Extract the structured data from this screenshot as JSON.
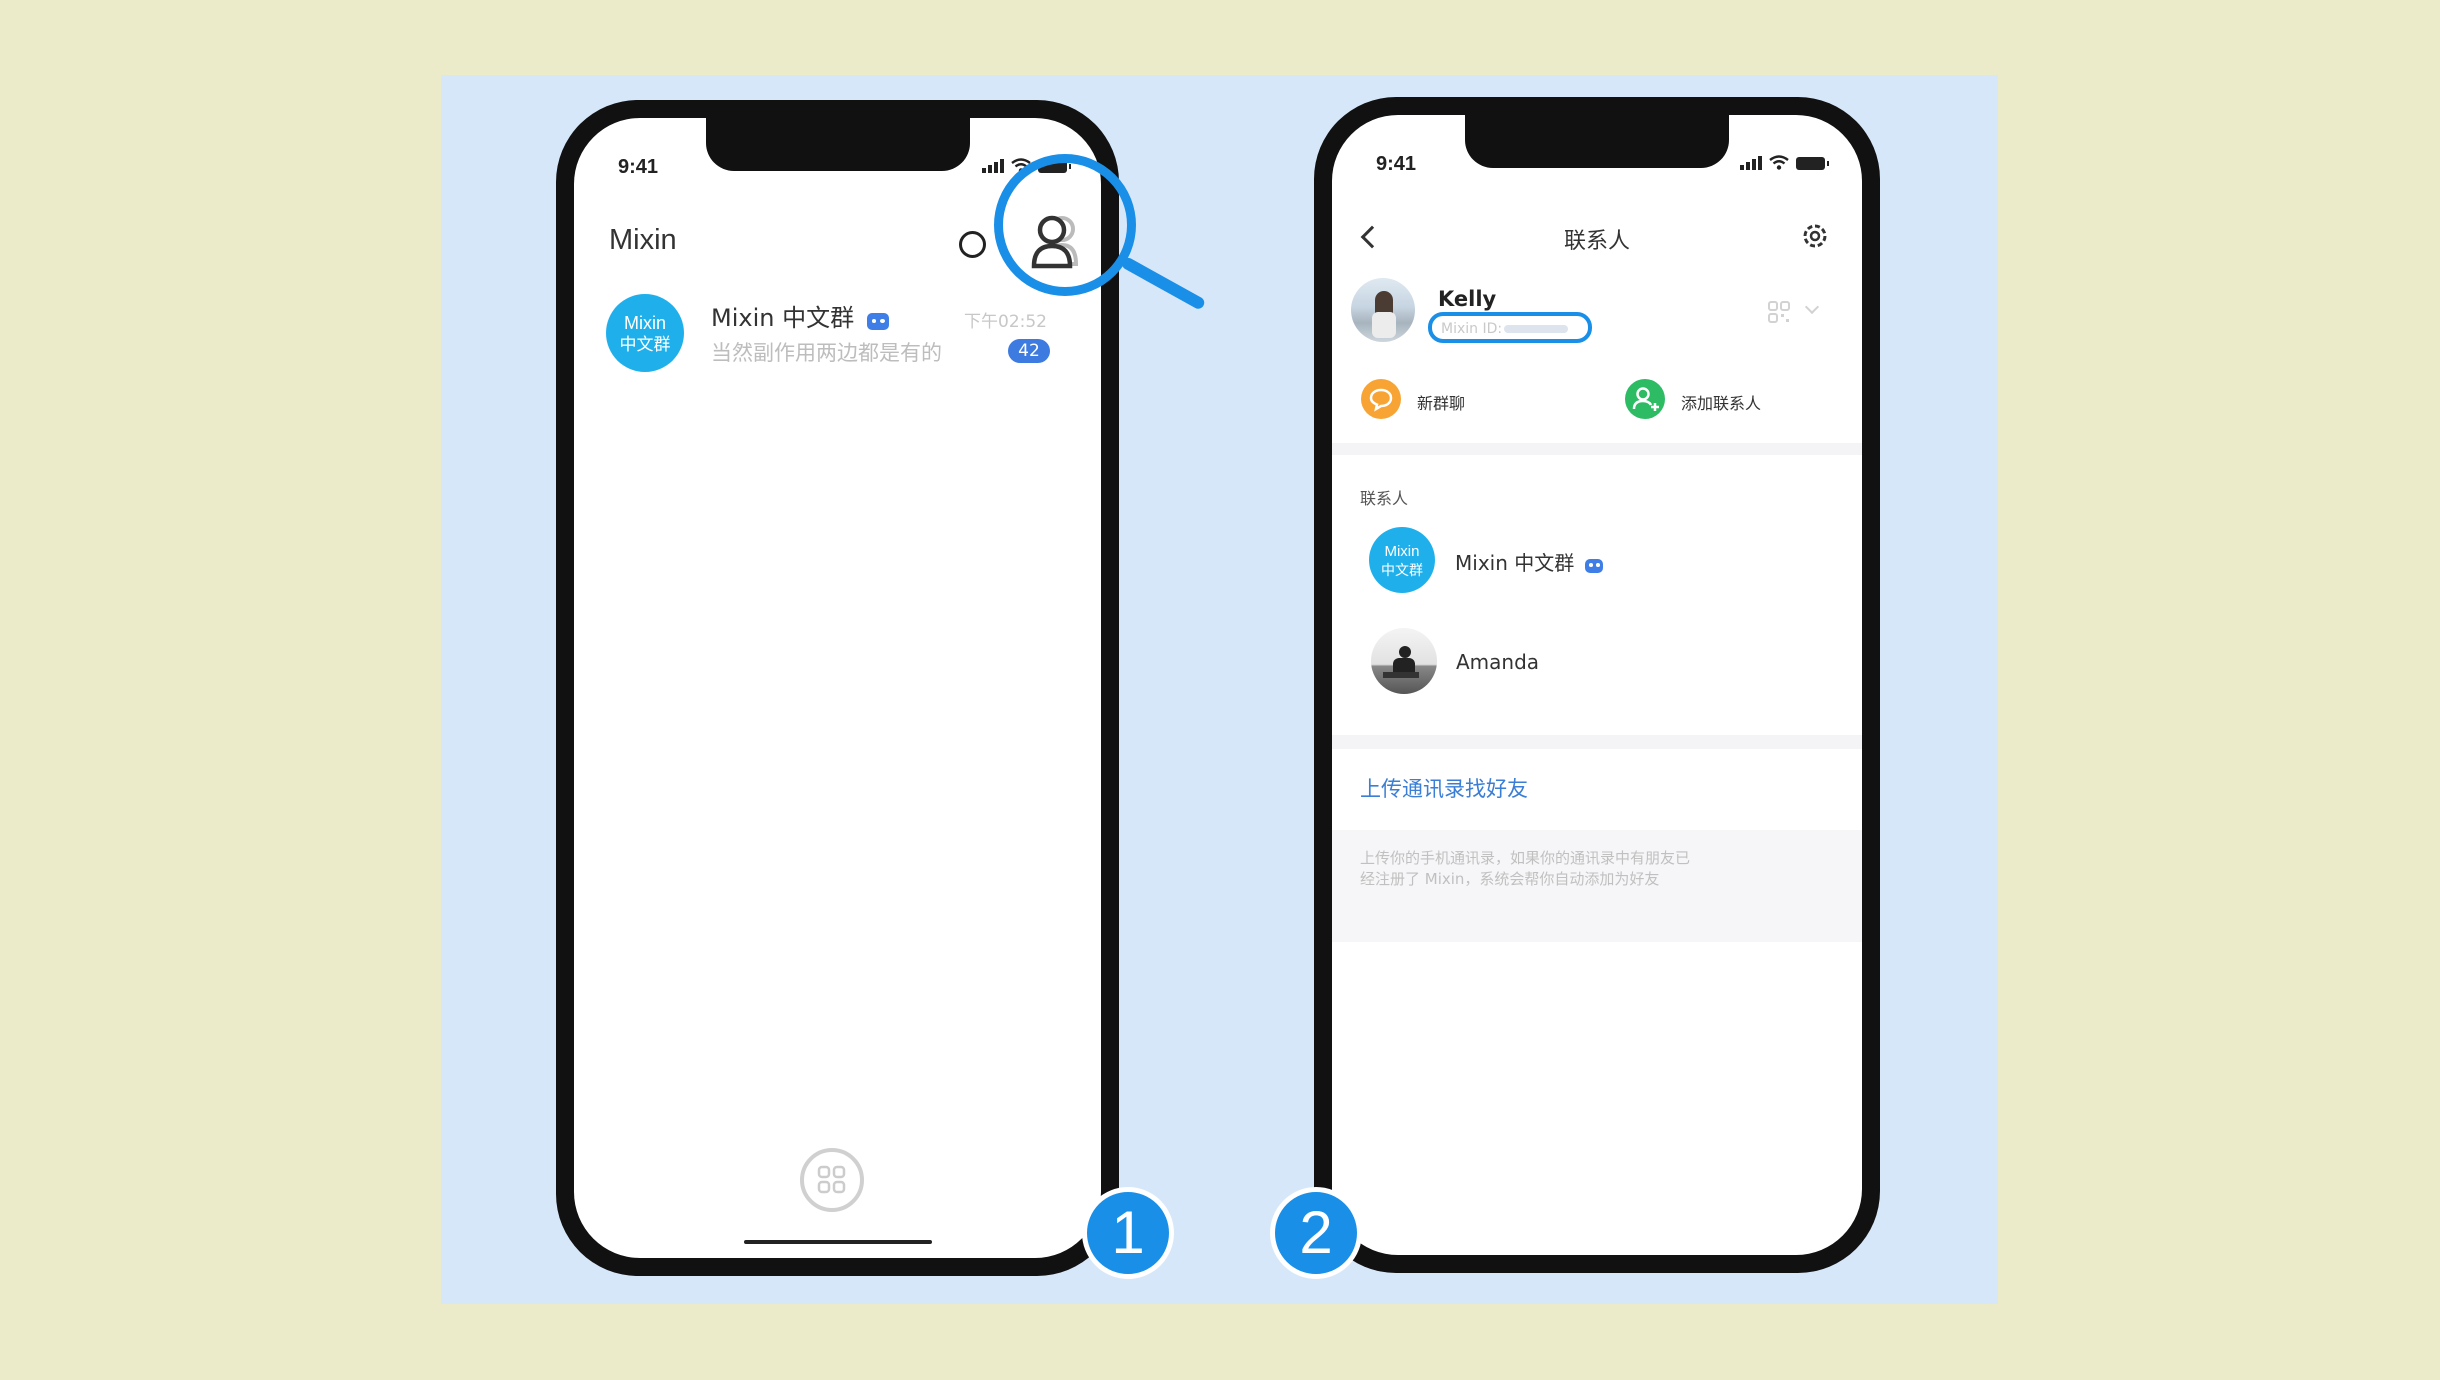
{
  "left": {
    "status_time": "9:41",
    "app_title": "Mixin",
    "chat": {
      "avatar_line1": "Mixin",
      "avatar_line2": "中文群",
      "name": "Mixin 中文群",
      "time": "下午02:52",
      "preview": "当然副作用两边都是有的",
      "unread": "42"
    },
    "step_number": "1"
  },
  "right": {
    "status_time": "9:41",
    "title": "联系人",
    "profile": {
      "name": "Kelly",
      "mixin_id_label": "Mixin ID:"
    },
    "actions": {
      "new_group": "新群聊",
      "add_contact": "添加联系人"
    },
    "section_label": "联系人",
    "contacts": [
      {
        "avatar_line1": "Mixin",
        "avatar_line2": "中文群",
        "name": "Mixin 中文群"
      },
      {
        "name": "Amanda"
      }
    ],
    "upload_link": "上传通讯录找好友",
    "upload_desc_line1": "上传你的手机通讯录，如果你的通讯录中有朋友已",
    "upload_desc_line2": "经注册了 Mixin，系统会帮你自动添加为好友",
    "step_number": "2"
  },
  "colors": {
    "background": "#ebebca",
    "panel": "#d7e7fa",
    "accent_blue": "#1a8fe8",
    "link_blue": "#3a7fd5",
    "bot_badge": "#3e7ee6",
    "new_group_orange": "#f7a435",
    "add_contact_green": "#2dbb63"
  }
}
